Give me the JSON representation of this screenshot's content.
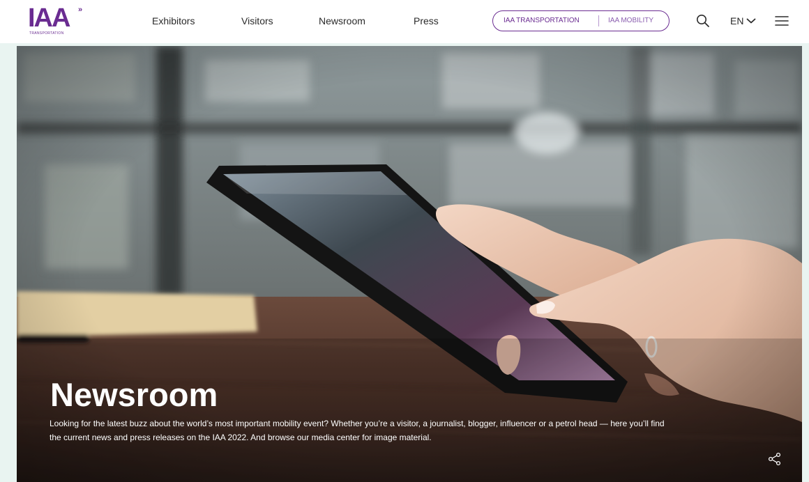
{
  "logo": {
    "main": "IAA",
    "marks": "»",
    "sub": "TRANSPORTATION"
  },
  "nav": {
    "items": [
      {
        "label": "Exhibitors"
      },
      {
        "label": "Visitors"
      },
      {
        "label": "Newsroom"
      },
      {
        "label": "Press"
      }
    ]
  },
  "brand_switch": {
    "transportation": "IAA TRANSPORTATION",
    "mobility": "IAA MOBILITY"
  },
  "header_icons": {
    "search": "search-icon",
    "language": "EN",
    "language_icon": "chevron-down-icon",
    "menu": "hamburger-menu-icon"
  },
  "hero": {
    "title": "Newsroom",
    "text": "Looking for the latest buzz about the world’s most important mobility event? Whether you’re a visitor, a journalist, blogger, influencer or a petrol head — here you’ll find the current news and press releases on the IAA 2022. And browse our media center for image material.",
    "share_icon": "share-icon"
  },
  "colors": {
    "brand": "#6a2c91",
    "hero_frame": "#e9f4f1",
    "text_dark": "#2a2a2a",
    "text_light": "#ffffff"
  }
}
